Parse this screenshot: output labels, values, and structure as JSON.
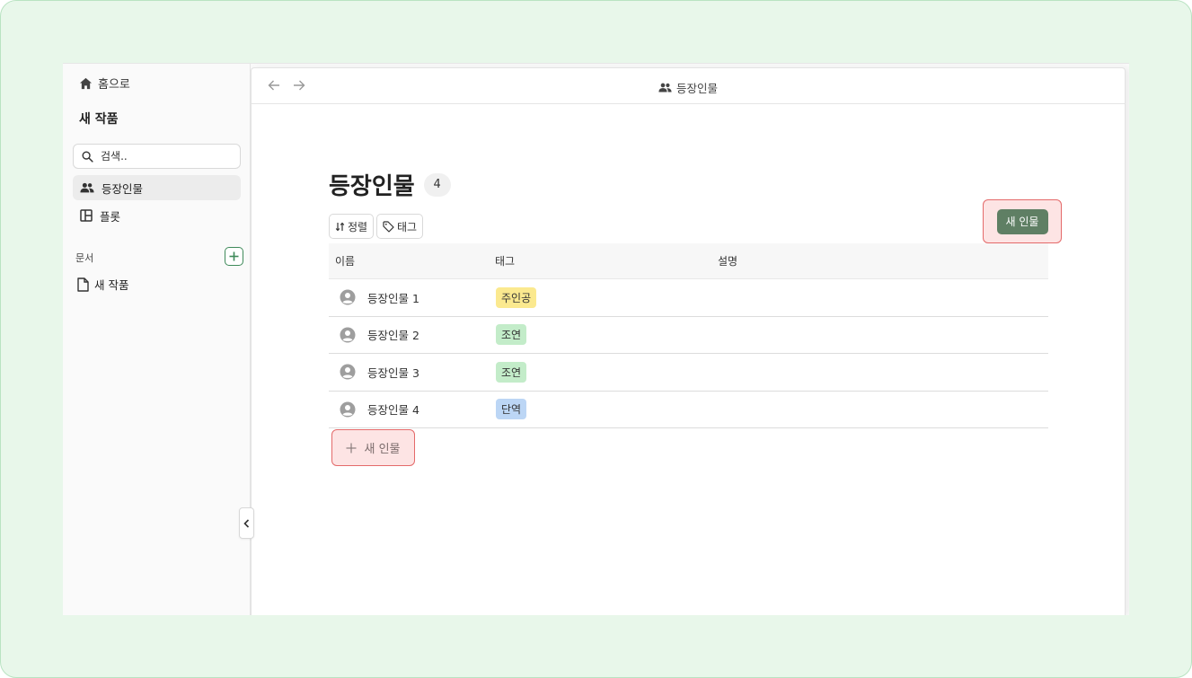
{
  "sidebar": {
    "home_label": "홈으로",
    "project_title": "새 작품",
    "search_placeholder": "검색..",
    "nav": [
      {
        "label": "등장인물",
        "icon": "people-icon",
        "active": true
      },
      {
        "label": "플롯",
        "icon": "layout-icon",
        "active": false
      }
    ],
    "docs_section_label": "문서",
    "docs": [
      {
        "label": "새 작품",
        "icon": "document-icon"
      }
    ]
  },
  "topbar": {
    "title": "등장인물",
    "title_icon": "people-icon"
  },
  "page": {
    "heading": "등장인물",
    "count": "4",
    "sort_label": "정렬",
    "tag_label": "태그",
    "new_button_label": "새 인물",
    "add_row_label": "새 인물"
  },
  "table": {
    "columns": [
      "이름",
      "태그",
      "설명"
    ],
    "rows": [
      {
        "name": "등장인물 1",
        "tag": "주인공",
        "tag_color": "#fbe98f",
        "description": ""
      },
      {
        "name": "등장인물 2",
        "tag": "조연",
        "tag_color": "#c3ecc9",
        "description": ""
      },
      {
        "name": "등장인물 3",
        "tag": "조연",
        "tag_color": "#c3ecc9",
        "description": ""
      },
      {
        "name": "등장인물 4",
        "tag": "단역",
        "tag_color": "#bcd6f5",
        "description": ""
      }
    ]
  },
  "colors": {
    "accent_green": "#5f7f64",
    "highlight_fill": "#fde4e4",
    "highlight_border": "#e46a6a"
  }
}
